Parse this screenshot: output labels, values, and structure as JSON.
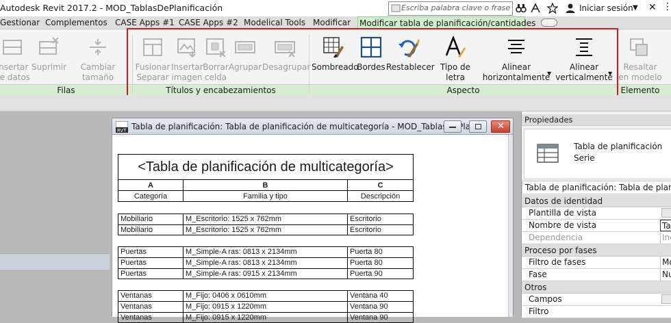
{
  "app_title": "Autodesk Revit 2017.2 -     MOD_TablasDePlanificación",
  "search": {
    "placeholder": "Escriba palabra clave o frase"
  },
  "signin": "Iniciar sesión",
  "tabs": [
    {
      "label": "Gestionar"
    },
    {
      "label": "Complementos"
    },
    {
      "label": "CASE Apps #1"
    },
    {
      "label": "CASE Apps #2"
    },
    {
      "label": "Modelical Tools"
    },
    {
      "label": "Modificar"
    },
    {
      "label": "Modificar tabla de planificación/cantidades"
    }
  ],
  "ribbon": {
    "filas": {
      "title": "Filas",
      "buttons": [
        {
          "label": "Insertar\nde datos",
          "icon": "insert-row-icon"
        },
        {
          "label": "Suprimir",
          "icon": "delete-row-icon"
        },
        {
          "label": "Cambiar tamaño",
          "icon": "resize-row-icon"
        }
      ]
    },
    "titulos": {
      "title": "Títulos y encabezamientos",
      "buttons": [
        {
          "label": "Fusionar\nSeparar",
          "icon": "merge-icon"
        },
        {
          "label": "Insertar\nimagen",
          "icon": "insert-image-icon"
        },
        {
          "label": "Borrar\ncelda",
          "icon": "clear-cell-icon"
        },
        {
          "label": "Agrupar",
          "icon": "group-icon"
        },
        {
          "label": "Desagrupar",
          "icon": "ungroup-icon"
        }
      ]
    },
    "aspecto": {
      "title": "Aspecto",
      "buttons": [
        {
          "label": "Sombreado",
          "icon": "shading-icon"
        },
        {
          "label": "Bordes",
          "icon": "borders-icon"
        },
        {
          "label": "Restablecer",
          "icon": "reset-icon"
        },
        {
          "label": "Tipo de letra",
          "icon": "font-icon"
        },
        {
          "label": "Alinear\nhorizontalmente",
          "icon": "align-horizontal-icon"
        },
        {
          "label": "Alinear\nverticalmente",
          "icon": "align-vertical-icon"
        }
      ]
    },
    "elemento": {
      "title": "Elemento",
      "buttons": [
        {
          "label": "Resaltar\nen modelo",
          "icon": "highlight-model-icon"
        }
      ]
    }
  },
  "schedule_window": {
    "title": "Tabla de planificación: Tabla de planificación de multicategoría - MOD_TablasDePla...",
    "table_title": "<Tabla de planificación de multicategoría>",
    "col_letters": [
      "A",
      "B",
      "C"
    ],
    "headers": [
      "Categoría",
      "Familia y tipo",
      "Descripción"
    ],
    "groups": [
      [
        [
          "Mobiliario",
          "M_Escritorio: 1525 x 762mm",
          "Escritorio"
        ],
        [
          "Mobiliario",
          "M_Escritorio: 1525 x 762mm",
          "Escritorio"
        ]
      ],
      [
        [
          "Puertas",
          "M_Simple-A ras: 0813 x 2134mm",
          "Puerta 80"
        ],
        [
          "Puertas",
          "M_Simple-A ras: 0813 x 2134mm",
          "Puerta 80"
        ],
        [
          "Puertas",
          "M_Simple-A ras: 0915 x 2134mm",
          "Puerta 90"
        ]
      ],
      [
        [
          "Ventanas",
          "M_Fijo: 0406 x 0610mm",
          "Ventana 40"
        ],
        [
          "Ventanas",
          "M_Fijo: 0915 x 1220mm",
          "Ventana 90"
        ],
        [
          "Ventanas",
          "M_Fijo: 0915 x 1220mm",
          "Ventana 90"
        ]
      ]
    ]
  },
  "properties": {
    "header": "Propiedades",
    "type_name_1": "Tabla de planificación",
    "type_name_2": "Serie",
    "instance": "Tabla de planificación: Tabla de planificación",
    "sections": [
      {
        "name": "Datos de identidad",
        "rows": [
          {
            "label": "Plantilla de vista",
            "value": "",
            "button": true,
            "disabled": false
          },
          {
            "label": "Nombre de vista",
            "value": "Ta",
            "button": false,
            "disabled": false
          },
          {
            "label": "Dependencia",
            "value": "Inc",
            "button": false,
            "disabled": true
          }
        ]
      },
      {
        "name": "Proceso por fases",
        "rows": [
          {
            "label": "Filtro de fases",
            "value": "Mo",
            "button": false,
            "disabled": false
          },
          {
            "label": "Fase",
            "value": "Nu",
            "button": false,
            "disabled": false
          }
        ]
      },
      {
        "name": "Otros",
        "rows": [
          {
            "label": "Campos",
            "value": "",
            "button": true,
            "disabled": false
          },
          {
            "label": "Filtro",
            "value": "",
            "button": false,
            "disabled": false
          }
        ]
      }
    ]
  }
}
